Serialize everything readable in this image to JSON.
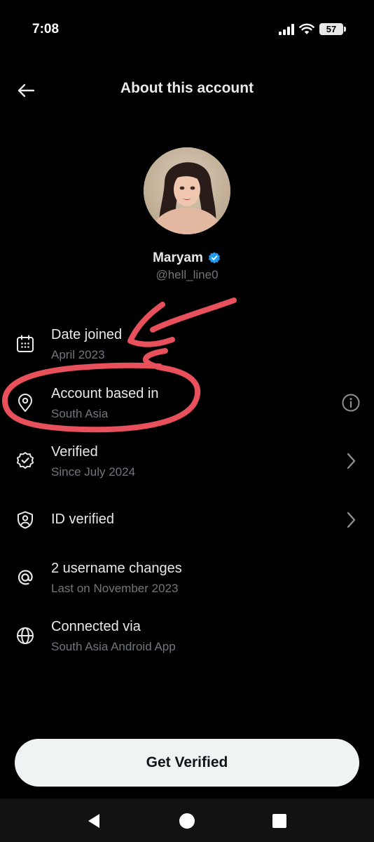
{
  "status_bar": {
    "time": "7:08",
    "battery_level": "57"
  },
  "header": {
    "title": "About this account"
  },
  "profile": {
    "name": "Maryam",
    "handle": "@hell_line0",
    "verified_badge_color": "#1d9bf0"
  },
  "details": [
    {
      "title": "Date joined",
      "subtitle": "April 2023",
      "icon": "calendar-icon"
    },
    {
      "title": "Account based in",
      "subtitle": "South Asia",
      "icon": "location-pin-icon",
      "trailing": "info-icon"
    },
    {
      "title": "Verified",
      "subtitle": "Since July 2024",
      "icon": "verified-badge-icon",
      "trailing": "chevron-right-icon"
    },
    {
      "title": "ID verified",
      "subtitle": "",
      "icon": "id-shield-icon",
      "trailing": "chevron-right-icon"
    },
    {
      "title": "2 username changes",
      "subtitle": "Last on November 2023",
      "icon": "at-sign-icon"
    },
    {
      "title": "Connected via",
      "subtitle": "South Asia Android App",
      "icon": "globe-icon"
    }
  ],
  "cta": {
    "label": "Get Verified"
  },
  "annotation": {
    "color": "#e8505b"
  },
  "colors": {
    "background": "#000000",
    "primary_text": "#e7e9ea",
    "secondary_text": "#71767b"
  }
}
